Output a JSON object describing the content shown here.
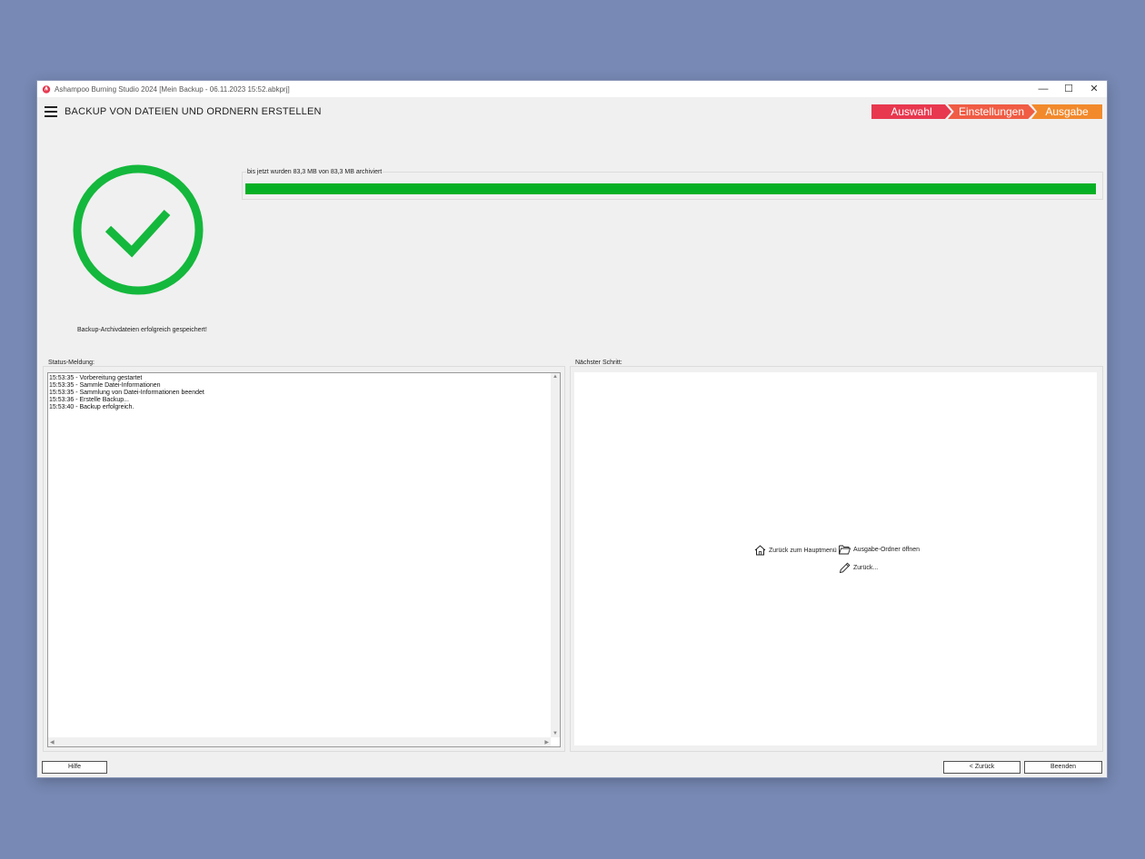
{
  "window": {
    "title": "Ashampoo Burning Studio 2024 [Mein Backup - 06.11.2023 15:52.abkprj]",
    "controls": {
      "minimize": "—",
      "maximize": "☐",
      "close": "✕"
    }
  },
  "header": {
    "title": "BACKUP VON DATEIEN UND ORDNERN ERSTELLEN",
    "steps": [
      "Auswahl",
      "Einstellungen",
      "Ausgabe"
    ]
  },
  "colors": {
    "success": "#14b83c",
    "progress": "#06b025",
    "step_auswahl": "#e8384f",
    "step_einstellungen": "#f05c44",
    "step_ausgabe": "#f28a2c"
  },
  "result": {
    "message": "Backup-Archivdateien erfolgreich gespeichert!",
    "icon": "success-check-icon"
  },
  "progress": {
    "label": "bis jetzt wurden  83,3 MB von  83,3 MB archiviert",
    "fraction": 1.0
  },
  "status": {
    "label": "Status-Meldung:",
    "lines": [
      "15:53:35 - Vorbereitung gestartet",
      "15:53:35 - Sammle Datei-Informationen",
      "15:53:35 - Sammlung von Datei-Informationen beendet",
      "15:53:36 - Erstelle Backup...",
      "15:53:40 - Backup erfolgreich."
    ]
  },
  "next_step": {
    "label": "Nächster Schritt:",
    "actions": {
      "main_menu": "Zurück zum Hauptmenü",
      "open_folder": "Ausgabe-Ordner öffnen",
      "back": "Zurück..."
    }
  },
  "footer": {
    "help": "Hilfe",
    "back": "< Zurück",
    "finish": "Beenden"
  }
}
